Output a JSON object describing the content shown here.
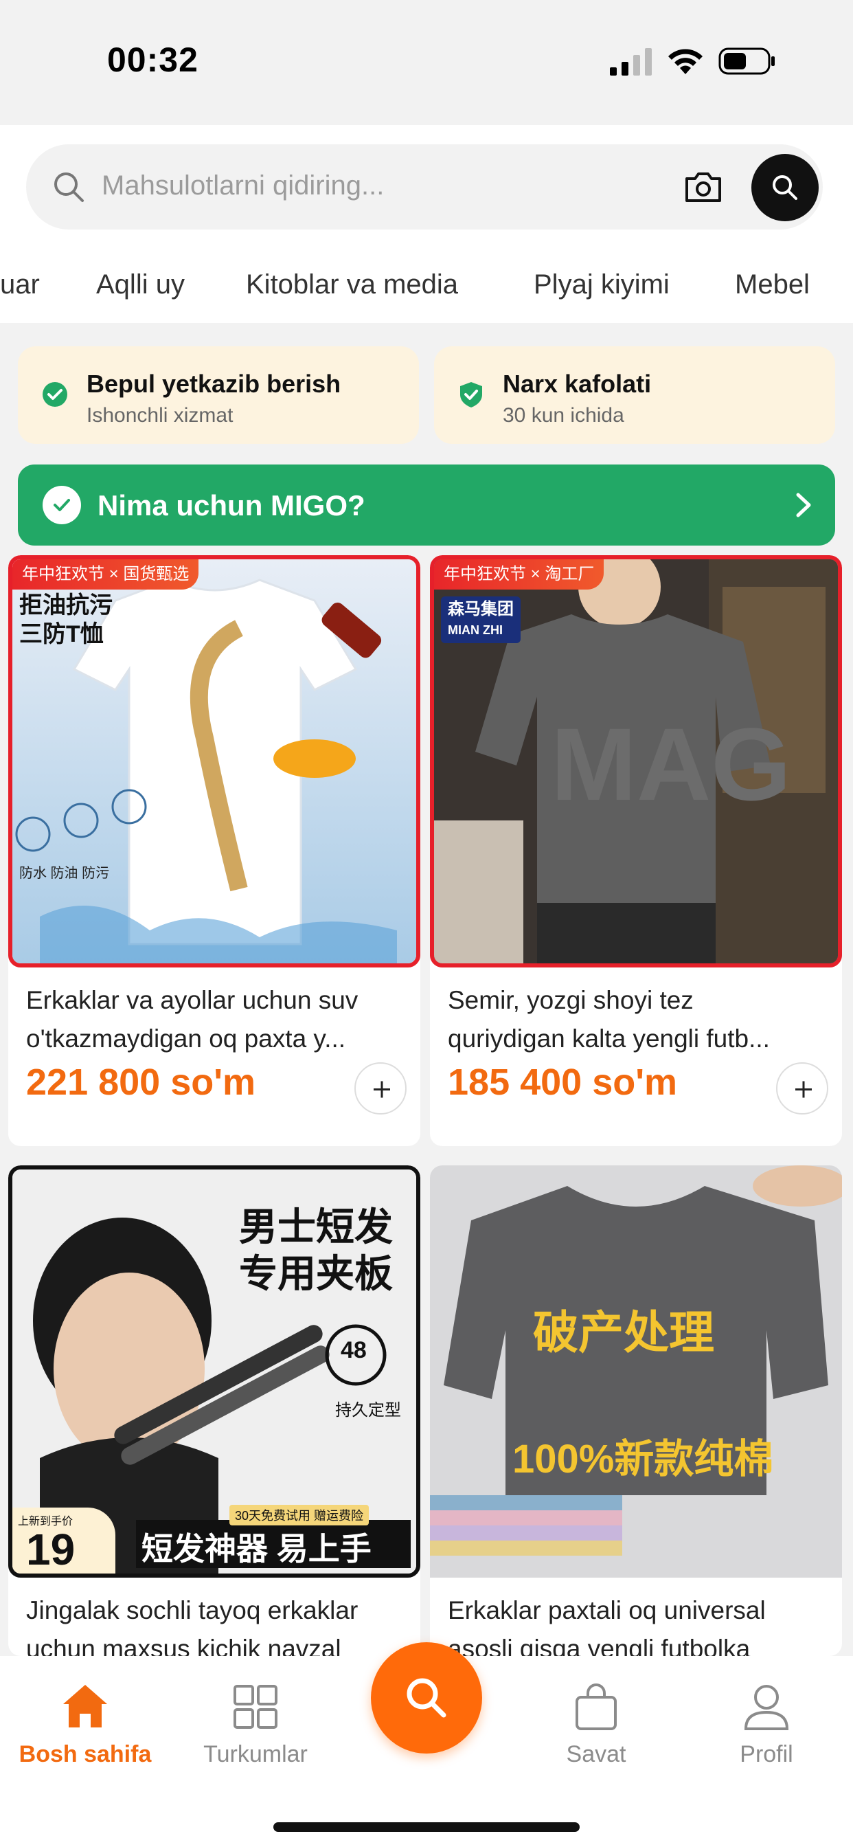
{
  "status": {
    "time": "00:32"
  },
  "search": {
    "placeholder": "Mahsulotlarni qidiring..."
  },
  "categories": [
    "uar",
    "Aqlli uy",
    "Kitoblar va media",
    "Plyaj kiyimi",
    "Mebel"
  ],
  "features": [
    {
      "title": "Bepul yetkazib berish",
      "subtitle": "Ishonchli xizmat",
      "icon": "check-circle-icon"
    },
    {
      "title": "Narx kafolati",
      "subtitle": "30 kun ichida",
      "icon": "shield-check-icon"
    }
  ],
  "why": {
    "label": "Nima uchun MIGO?"
  },
  "products": [
    {
      "promo": "年中狂欢节 × 国货甄选",
      "name_line1": "Erkaklar va ayollar uchun suv",
      "name_line2": "o'tkazmaydigan oq paxta y...",
      "price": "221 800 so'm",
      "img_text1": "拒油抗污",
      "img_text2": "三防T恤",
      "img_text3": "防水  防油  防污"
    },
    {
      "promo": "年中狂欢节 × 淘工厂",
      "name_line1": "Semir, yozgi shoyi tez",
      "name_line2": "quriydigan kalta yengli futb...",
      "price": "185 400 so'm",
      "img_text1": "森马集团",
      "img_text2": "MIAN ZHI"
    },
    {
      "name_line1": "Jingalak sochli tayoq erkaklar",
      "name_line2": "uchun maxsus kichik navzal",
      "img_text1": "男士短发",
      "img_text2": "专用夹板",
      "img_text3": "48",
      "img_text4": "持久定型",
      "img_text5": "短发神器 易上手",
      "img_text6": "30天免费试用 赠运费险",
      "img_text7": "19",
      "img_text8": "上新到手价"
    },
    {
      "name_line1": "Erkaklar paxtali oq universal",
      "name_line2": "asosli qisqa yengli futbolka",
      "img_text1": "破产处理",
      "img_text2": "100%新款纯棉"
    }
  ],
  "nav": {
    "home": "Bosh sahifa",
    "categories": "Turkumlar",
    "cart": "Savat",
    "profile": "Profil"
  },
  "colors": {
    "accent": "#f26a10",
    "green": "#22a866",
    "promo_red": "#e6202a"
  }
}
